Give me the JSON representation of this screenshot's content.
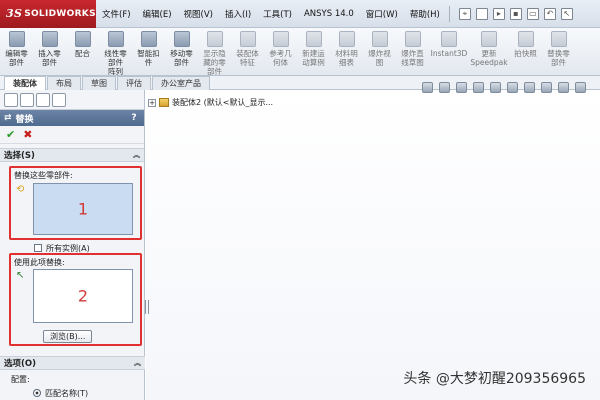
{
  "app": {
    "logo_prefix": "3S",
    "logo_name": "SOLIDWORKS"
  },
  "menu": [
    "文件(F)",
    "编辑(E)",
    "视图(V)",
    "插入(I)",
    "工具(T)",
    "ANSYS 14.0",
    "窗口(W)",
    "帮助(H)"
  ],
  "ribbon": {
    "tools": [
      {
        "label": "编辑零\n部件",
        "enabled": true
      },
      {
        "label": "插入零\n部件",
        "enabled": true
      },
      {
        "label": "配合",
        "enabled": true
      },
      {
        "label": "线性零\n部件\n阵列",
        "enabled": true
      },
      {
        "label": "智能扣\n件",
        "enabled": true
      },
      {
        "label": "移动零\n部件",
        "enabled": true
      },
      {
        "label": "显示隐\n藏的零\n部件",
        "enabled": false
      },
      {
        "label": "装配体\n特征",
        "enabled": false
      },
      {
        "label": "参考几\n何体",
        "enabled": false
      },
      {
        "label": "新建运\n动算例",
        "enabled": false
      },
      {
        "label": "材料明\n细表",
        "enabled": false
      },
      {
        "label": "爆炸视\n图",
        "enabled": false
      },
      {
        "label": "爆炸直\n线草图",
        "enabled": false
      },
      {
        "label": "Instant3D",
        "enabled": false
      },
      {
        "label": "更新\nSpeedpak",
        "enabled": false
      },
      {
        "label": "拍快照",
        "enabled": false
      },
      {
        "label": "替换零\n部件",
        "enabled": false
      }
    ]
  },
  "tabs": [
    {
      "label": "装配体",
      "active": true
    },
    {
      "label": "布局",
      "active": false
    },
    {
      "label": "草图",
      "active": false
    },
    {
      "label": "评估",
      "active": false
    },
    {
      "label": "办公室产品",
      "active": false
    }
  ],
  "property_manager": {
    "title": "替换",
    "help": "?",
    "ok_symbol": "✔",
    "cancel_symbol": "✖",
    "selection_group": "选择(S)",
    "replace_label": "替换这些零部件:",
    "box1_number": "1",
    "all_instances_label": "所有实例(A)",
    "use_label": "使用此项替换:",
    "box2_number": "2",
    "browse_label": "浏览(B)...",
    "options_group": "选项(O)",
    "config_label": "配置:",
    "match_name_label": "匹配名称(T)"
  },
  "tree": {
    "expander": "+",
    "item": "装配体2 (默认<默认_显示..."
  },
  "watermark": "头条 @大梦初醒209356965",
  "colors": {
    "highlight_box": "#e03030",
    "box_number": "#d23a3a",
    "selection_fill": "#c9dcf2"
  }
}
